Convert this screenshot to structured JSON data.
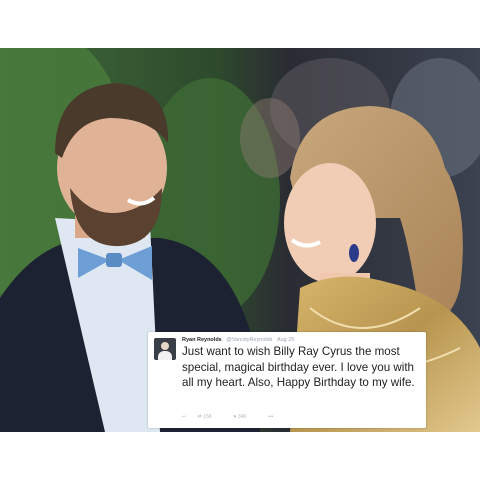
{
  "tweet": {
    "author": "Ryan Reynolds",
    "handle": "@VancityReynolds",
    "time": "Aug 25",
    "text": "Just want to wish Billy Ray Cyrus the most special, magical birthday ever. I love you with all my heart. Also, Happy Birthday to my wife.",
    "retweets": "15K",
    "likes": "34K"
  },
  "colors": {
    "page_background": "#ffffff",
    "tweet_text": "#1f1f1f",
    "tweet_meta": "#9aa3ac"
  }
}
